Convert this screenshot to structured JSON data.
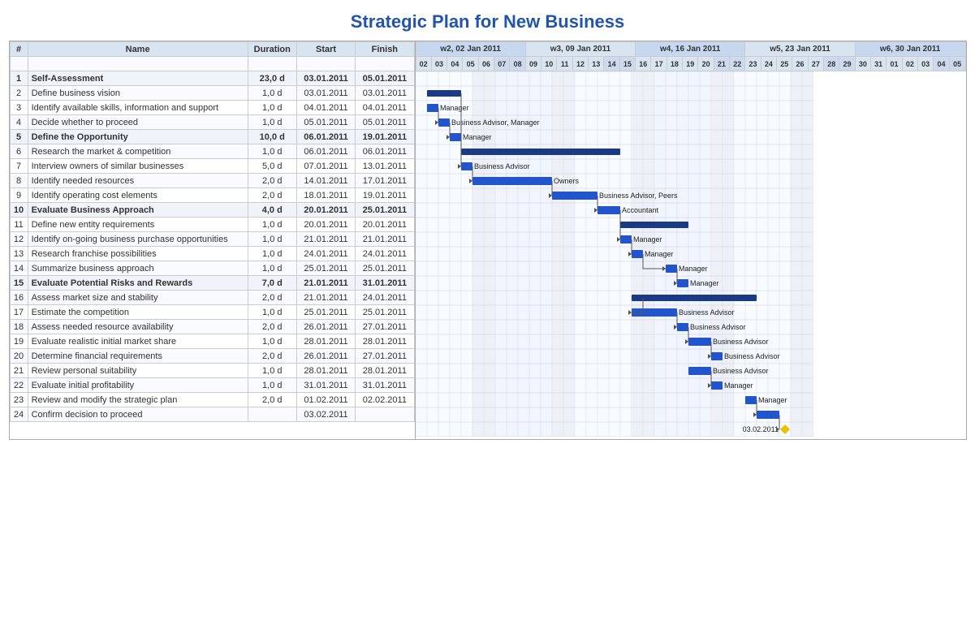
{
  "title": "Strategic Plan for New Business",
  "table": {
    "headers": [
      "#",
      "Name",
      "Duration",
      "Start",
      "Finish"
    ],
    "rows": [
      {
        "num": "",
        "name": "",
        "dur": "",
        "start": "",
        "finish": "",
        "type": "blank"
      },
      {
        "num": "1",
        "name": "Self-Assessment",
        "dur": "23,0 d",
        "start": "03.01.2011",
        "finish": "05.01.2011",
        "type": "summary"
      },
      {
        "num": "2",
        "name": "Define business vision",
        "dur": "1,0 d",
        "start": "03.01.2011",
        "finish": "03.01.2011",
        "type": "normal"
      },
      {
        "num": "3",
        "name": "Identify available skills, information and support",
        "dur": "1,0 d",
        "start": "04.01.2011",
        "finish": "04.01.2011",
        "type": "normal"
      },
      {
        "num": "4",
        "name": "Decide whether to proceed",
        "dur": "1,0 d",
        "start": "05.01.2011",
        "finish": "05.01.2011",
        "type": "normal"
      },
      {
        "num": "5",
        "name": "Define the Opportunity",
        "dur": "10,0 d",
        "start": "06.01.2011",
        "finish": "19.01.2011",
        "type": "summary"
      },
      {
        "num": "6",
        "name": "Research the market & competition",
        "dur": "1,0 d",
        "start": "06.01.2011",
        "finish": "06.01.2011",
        "type": "normal"
      },
      {
        "num": "7",
        "name": "Interview owners of similar businesses",
        "dur": "5,0 d",
        "start": "07.01.2011",
        "finish": "13.01.2011",
        "type": "normal"
      },
      {
        "num": "8",
        "name": "Identify needed resources",
        "dur": "2,0 d",
        "start": "14.01.2011",
        "finish": "17.01.2011",
        "type": "normal"
      },
      {
        "num": "9",
        "name": "Identify operating cost elements",
        "dur": "2,0 d",
        "start": "18.01.2011",
        "finish": "19.01.2011",
        "type": "normal"
      },
      {
        "num": "10",
        "name": "Evaluate Business Approach",
        "dur": "4,0 d",
        "start": "20.01.2011",
        "finish": "25.01.2011",
        "type": "summary"
      },
      {
        "num": "11",
        "name": "Define new entity requirements",
        "dur": "1,0 d",
        "start": "20.01.2011",
        "finish": "20.01.2011",
        "type": "normal"
      },
      {
        "num": "12",
        "name": "Identify on-going business purchase opportunities",
        "dur": "1,0 d",
        "start": "21.01.2011",
        "finish": "21.01.2011",
        "type": "normal"
      },
      {
        "num": "13",
        "name": "Research franchise possibilities",
        "dur": "1,0 d",
        "start": "24.01.2011",
        "finish": "24.01.2011",
        "type": "normal"
      },
      {
        "num": "14",
        "name": "Summarize business approach",
        "dur": "1,0 d",
        "start": "25.01.2011",
        "finish": "25.01.2011",
        "type": "normal"
      },
      {
        "num": "15",
        "name": "Evaluate Potential Risks and Rewards",
        "dur": "7,0 d",
        "start": "21.01.2011",
        "finish": "31.01.2011",
        "type": "summary"
      },
      {
        "num": "16",
        "name": "Assess market size and stability",
        "dur": "2,0 d",
        "start": "21.01.2011",
        "finish": "24.01.2011",
        "type": "normal"
      },
      {
        "num": "17",
        "name": "Estimate the competition",
        "dur": "1,0 d",
        "start": "25.01.2011",
        "finish": "25.01.2011",
        "type": "normal"
      },
      {
        "num": "18",
        "name": "Assess needed resource availability",
        "dur": "2,0 d",
        "start": "26.01.2011",
        "finish": "27.01.2011",
        "type": "normal"
      },
      {
        "num": "19",
        "name": "Evaluate realistic initial market share",
        "dur": "1,0 d",
        "start": "28.01.2011",
        "finish": "28.01.2011",
        "type": "normal"
      },
      {
        "num": "20",
        "name": "Determine financial requirements",
        "dur": "2,0 d",
        "start": "26.01.2011",
        "finish": "27.01.2011",
        "type": "normal"
      },
      {
        "num": "21",
        "name": "Review personal suitability",
        "dur": "1,0 d",
        "start": "28.01.2011",
        "finish": "28.01.2011",
        "type": "normal"
      },
      {
        "num": "22",
        "name": "Evaluate initial profitability",
        "dur": "1,0 d",
        "start": "31.01.2011",
        "finish": "31.01.2011",
        "type": "normal"
      },
      {
        "num": "23",
        "name": "Review and modify the strategic plan",
        "dur": "2,0 d",
        "start": "01.02.2011",
        "finish": "02.02.2011",
        "type": "normal"
      },
      {
        "num": "24",
        "name": "Confirm decision to proceed",
        "dur": "",
        "start": "03.02.2011",
        "finish": "",
        "type": "milestone"
      }
    ]
  },
  "gantt": {
    "weeks": [
      {
        "label": "w2, 02 Jan 2011",
        "cols": 7
      },
      {
        "label": "w3, 09 Jan 2011",
        "cols": 7
      },
      {
        "label": "w4, 16 Jan 2011",
        "cols": 7
      },
      {
        "label": "w5, 23 Jan 2011",
        "cols": 7
      },
      {
        "label": "w6, 30 Jan 2011",
        "cols": 7
      }
    ],
    "days": [
      "02",
      "03",
      "04",
      "05",
      "06",
      "07",
      "08",
      "09",
      "10",
      "11",
      "12",
      "13",
      "14",
      "15",
      "16",
      "17",
      "18",
      "19",
      "20",
      "21",
      "22",
      "23",
      "24",
      "25",
      "26",
      "27",
      "28",
      "29",
      "30",
      "31",
      "01",
      "02",
      "03",
      "04",
      "05"
    ]
  }
}
